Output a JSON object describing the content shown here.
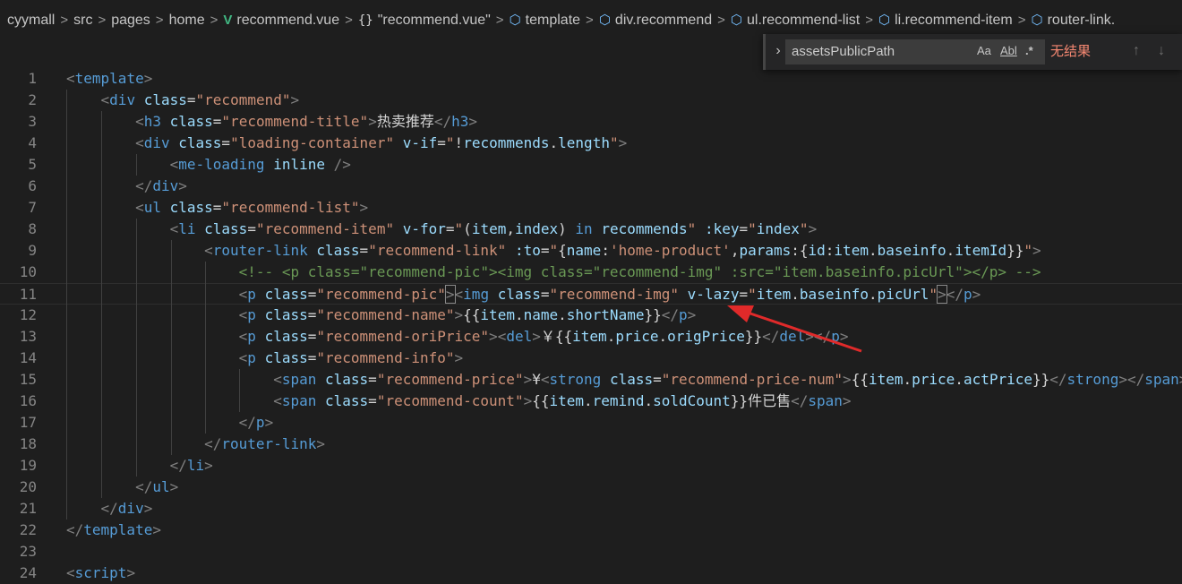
{
  "breadcrumb": [
    {
      "label": "cyymall",
      "icon": ""
    },
    {
      "label": "src",
      "icon": ""
    },
    {
      "label": "pages",
      "icon": ""
    },
    {
      "label": "home",
      "icon": ""
    },
    {
      "label": "recommend.vue",
      "icon": "vue-icon"
    },
    {
      "label": "\"recommend.vue\"",
      "icon": "braces-icon"
    },
    {
      "label": "template",
      "icon": "cube-icon"
    },
    {
      "label": "div.recommend",
      "icon": "cube-icon"
    },
    {
      "label": "ul.recommend-list",
      "icon": "cube-icon"
    },
    {
      "label": "li.recommend-item",
      "icon": "cube-icon"
    },
    {
      "label": "router-link.",
      "icon": "cube-icon"
    }
  ],
  "find_widget": {
    "query": "assetsPublicPath",
    "option_case": "Aa",
    "option_word": "Abl",
    "option_regex": ".*",
    "result": "无结果",
    "prev_icon": "arrow-up-icon",
    "next_icon": "arrow-down-icon"
  },
  "editor": {
    "current_line": 11,
    "lines": [
      {
        "n": "1",
        "tokens": [
          [
            "b",
            "<"
          ],
          [
            "t",
            "template"
          ],
          [
            "b",
            ">"
          ]
        ]
      },
      {
        "n": "2",
        "tokens": [
          [
            "x",
            "    "
          ],
          [
            "b",
            "<"
          ],
          [
            "t",
            "div"
          ],
          [
            "x",
            " "
          ],
          [
            "a",
            "class"
          ],
          [
            "x",
            "="
          ],
          [
            "s",
            "\"recommend\""
          ],
          [
            "b",
            ">"
          ]
        ]
      },
      {
        "n": "3",
        "tokens": [
          [
            "x",
            "        "
          ],
          [
            "b",
            "<"
          ],
          [
            "t",
            "h3"
          ],
          [
            "x",
            " "
          ],
          [
            "a",
            "class"
          ],
          [
            "x",
            "="
          ],
          [
            "s",
            "\"recommend-title\""
          ],
          [
            "b",
            ">"
          ],
          [
            "x",
            "热卖推荐"
          ],
          [
            "b",
            "</"
          ],
          [
            "t",
            "h3"
          ],
          [
            "b",
            ">"
          ]
        ]
      },
      {
        "n": "4",
        "tokens": [
          [
            "x",
            "        "
          ],
          [
            "b",
            "<"
          ],
          [
            "t",
            "div"
          ],
          [
            "x",
            " "
          ],
          [
            "a",
            "class"
          ],
          [
            "x",
            "="
          ],
          [
            "s",
            "\"loading-container\""
          ],
          [
            "x",
            " "
          ],
          [
            "a",
            "v-if"
          ],
          [
            "x",
            "="
          ],
          [
            "s",
            "\""
          ],
          [
            "x",
            "!"
          ],
          [
            "v",
            "recommends"
          ],
          [
            "x",
            "."
          ],
          [
            "v",
            "length"
          ],
          [
            "s",
            "\""
          ],
          [
            "b",
            ">"
          ]
        ]
      },
      {
        "n": "5",
        "tokens": [
          [
            "x",
            "            "
          ],
          [
            "b",
            "<"
          ],
          [
            "t",
            "me-loading"
          ],
          [
            "x",
            " "
          ],
          [
            "a",
            "inline"
          ],
          [
            "x",
            " "
          ],
          [
            "b",
            "/>"
          ]
        ]
      },
      {
        "n": "6",
        "tokens": [
          [
            "x",
            "        "
          ],
          [
            "b",
            "</"
          ],
          [
            "t",
            "div"
          ],
          [
            "b",
            ">"
          ]
        ]
      },
      {
        "n": "7",
        "tokens": [
          [
            "x",
            "        "
          ],
          [
            "b",
            "<"
          ],
          [
            "t",
            "ul"
          ],
          [
            "x",
            " "
          ],
          [
            "a",
            "class"
          ],
          [
            "x",
            "="
          ],
          [
            "s",
            "\"recommend-list\""
          ],
          [
            "b",
            ">"
          ]
        ]
      },
      {
        "n": "8",
        "tokens": [
          [
            "x",
            "            "
          ],
          [
            "b",
            "<"
          ],
          [
            "t",
            "li"
          ],
          [
            "x",
            " "
          ],
          [
            "a",
            "class"
          ],
          [
            "x",
            "="
          ],
          [
            "s",
            "\"recommend-item\""
          ],
          [
            "x",
            " "
          ],
          [
            "a",
            "v-for"
          ],
          [
            "x",
            "="
          ],
          [
            "s",
            "\""
          ],
          [
            "x",
            "("
          ],
          [
            "v",
            "item"
          ],
          [
            "x",
            ","
          ],
          [
            "v",
            "index"
          ],
          [
            "x",
            ") "
          ],
          [
            "k",
            "in"
          ],
          [
            "x",
            " "
          ],
          [
            "v",
            "recommends"
          ],
          [
            "s",
            "\""
          ],
          [
            "x",
            " "
          ],
          [
            "a",
            ":key"
          ],
          [
            "x",
            "="
          ],
          [
            "s",
            "\""
          ],
          [
            "v",
            "index"
          ],
          [
            "s",
            "\""
          ],
          [
            "b",
            ">"
          ]
        ]
      },
      {
        "n": "9",
        "tokens": [
          [
            "x",
            "                "
          ],
          [
            "b",
            "<"
          ],
          [
            "t",
            "router-link"
          ],
          [
            "x",
            " "
          ],
          [
            "a",
            "class"
          ],
          [
            "x",
            "="
          ],
          [
            "s",
            "\"recommend-link\""
          ],
          [
            "x",
            " "
          ],
          [
            "a",
            ":to"
          ],
          [
            "x",
            "="
          ],
          [
            "s",
            "\""
          ],
          [
            "x",
            "{"
          ],
          [
            "v",
            "name"
          ],
          [
            "x",
            ":"
          ],
          [
            "s",
            "'home-product'"
          ],
          [
            "x",
            ","
          ],
          [
            "v",
            "params"
          ],
          [
            "x",
            ":{"
          ],
          [
            "v",
            "id"
          ],
          [
            "x",
            ":"
          ],
          [
            "v",
            "item"
          ],
          [
            "x",
            "."
          ],
          [
            "v",
            "baseinfo"
          ],
          [
            "x",
            "."
          ],
          [
            "v",
            "itemId"
          ],
          [
            "x",
            "}}"
          ],
          [
            "s",
            "\""
          ],
          [
            "b",
            ">"
          ]
        ]
      },
      {
        "n": "10",
        "tokens": [
          [
            "x",
            "                    "
          ],
          [
            "c",
            "<!-- <p class=\"recommend-pic\"><img class=\"recommend-img\" :src=\"item.baseinfo.picUrl\"></p> -->"
          ]
        ]
      },
      {
        "n": "11",
        "tokens": [
          [
            "x",
            "                    "
          ],
          [
            "b",
            "<"
          ],
          [
            "t",
            "p"
          ],
          [
            "x",
            " "
          ],
          [
            "a",
            "class"
          ],
          [
            "x",
            "="
          ],
          [
            "s",
            "\"recommend-pic\""
          ],
          [
            "m",
            ">"
          ],
          [
            "b",
            "<"
          ],
          [
            "t",
            "img"
          ],
          [
            "x",
            " "
          ],
          [
            "a",
            "class"
          ],
          [
            "x",
            "="
          ],
          [
            "s",
            "\"recommend-img\""
          ],
          [
            "x",
            " "
          ],
          [
            "a",
            "v-lazy"
          ],
          [
            "x",
            "="
          ],
          [
            "s",
            "\""
          ],
          [
            "v",
            "item"
          ],
          [
            "x",
            "."
          ],
          [
            "v",
            "baseinfo"
          ],
          [
            "x",
            "."
          ],
          [
            "v",
            "picUrl"
          ],
          [
            "s",
            "\""
          ],
          [
            "m",
            ">"
          ],
          [
            "b",
            "</"
          ],
          [
            "t",
            "p"
          ],
          [
            "b",
            ">"
          ]
        ]
      },
      {
        "n": "12",
        "tokens": [
          [
            "x",
            "                    "
          ],
          [
            "b",
            "<"
          ],
          [
            "t",
            "p"
          ],
          [
            "x",
            " "
          ],
          [
            "a",
            "class"
          ],
          [
            "x",
            "="
          ],
          [
            "s",
            "\"recommend-name\""
          ],
          [
            "b",
            ">"
          ],
          [
            "x",
            "{{"
          ],
          [
            "v",
            "item"
          ],
          [
            "x",
            "."
          ],
          [
            "v",
            "name"
          ],
          [
            "x",
            "."
          ],
          [
            "v",
            "shortName"
          ],
          [
            "x",
            "}}"
          ],
          [
            "b",
            "</"
          ],
          [
            "t",
            "p"
          ],
          [
            "b",
            ">"
          ]
        ]
      },
      {
        "n": "13",
        "tokens": [
          [
            "x",
            "                    "
          ],
          [
            "b",
            "<"
          ],
          [
            "t",
            "p"
          ],
          [
            "x",
            " "
          ],
          [
            "a",
            "class"
          ],
          [
            "x",
            "="
          ],
          [
            "s",
            "\"recommend-oriPrice\""
          ],
          [
            "b",
            ">"
          ],
          [
            "b",
            "<"
          ],
          [
            "t",
            "del"
          ],
          [
            "b",
            ">"
          ],
          [
            "x",
            "￥{{"
          ],
          [
            "v",
            "item"
          ],
          [
            "x",
            "."
          ],
          [
            "v",
            "price"
          ],
          [
            "x",
            "."
          ],
          [
            "v",
            "origPrice"
          ],
          [
            "x",
            "}}"
          ],
          [
            "b",
            "</"
          ],
          [
            "t",
            "del"
          ],
          [
            "b",
            ">"
          ],
          [
            "b",
            "</"
          ],
          [
            "t",
            "p"
          ],
          [
            "b",
            ">"
          ]
        ]
      },
      {
        "n": "14",
        "tokens": [
          [
            "x",
            "                    "
          ],
          [
            "b",
            "<"
          ],
          [
            "t",
            "p"
          ],
          [
            "x",
            " "
          ],
          [
            "a",
            "class"
          ],
          [
            "x",
            "="
          ],
          [
            "s",
            "\"recommend-info\""
          ],
          [
            "b",
            ">"
          ]
        ]
      },
      {
        "n": "15",
        "tokens": [
          [
            "x",
            "                        "
          ],
          [
            "b",
            "<"
          ],
          [
            "t",
            "span"
          ],
          [
            "x",
            " "
          ],
          [
            "a",
            "class"
          ],
          [
            "x",
            "="
          ],
          [
            "s",
            "\"recommend-price\""
          ],
          [
            "b",
            ">"
          ],
          [
            "x",
            "¥"
          ],
          [
            "b",
            "<"
          ],
          [
            "t",
            "strong"
          ],
          [
            "x",
            " "
          ],
          [
            "a",
            "class"
          ],
          [
            "x",
            "="
          ],
          [
            "s",
            "\"recommend-price-num\""
          ],
          [
            "b",
            ">"
          ],
          [
            "x",
            "{{"
          ],
          [
            "v",
            "item"
          ],
          [
            "x",
            "."
          ],
          [
            "v",
            "price"
          ],
          [
            "x",
            "."
          ],
          [
            "v",
            "actPrice"
          ],
          [
            "x",
            "}}"
          ],
          [
            "b",
            "</"
          ],
          [
            "t",
            "strong"
          ],
          [
            "b",
            "></"
          ],
          [
            "t",
            "span"
          ],
          [
            "b",
            ">"
          ]
        ]
      },
      {
        "n": "16",
        "tokens": [
          [
            "x",
            "                        "
          ],
          [
            "b",
            "<"
          ],
          [
            "t",
            "span"
          ],
          [
            "x",
            " "
          ],
          [
            "a",
            "class"
          ],
          [
            "x",
            "="
          ],
          [
            "s",
            "\"recommend-count\""
          ],
          [
            "b",
            ">"
          ],
          [
            "x",
            "{{"
          ],
          [
            "v",
            "item"
          ],
          [
            "x",
            "."
          ],
          [
            "v",
            "remind"
          ],
          [
            "x",
            "."
          ],
          [
            "v",
            "soldCount"
          ],
          [
            "x",
            "}}件已售"
          ],
          [
            "b",
            "</"
          ],
          [
            "t",
            "span"
          ],
          [
            "b",
            ">"
          ]
        ]
      },
      {
        "n": "17",
        "tokens": [
          [
            "x",
            "                    "
          ],
          [
            "b",
            "</"
          ],
          [
            "t",
            "p"
          ],
          [
            "b",
            ">"
          ]
        ]
      },
      {
        "n": "18",
        "tokens": [
          [
            "x",
            "                "
          ],
          [
            "b",
            "</"
          ],
          [
            "t",
            "router-link"
          ],
          [
            "b",
            ">"
          ]
        ]
      },
      {
        "n": "19",
        "tokens": [
          [
            "x",
            "            "
          ],
          [
            "b",
            "</"
          ],
          [
            "t",
            "li"
          ],
          [
            "b",
            ">"
          ]
        ]
      },
      {
        "n": "20",
        "tokens": [
          [
            "x",
            "        "
          ],
          [
            "b",
            "</"
          ],
          [
            "t",
            "ul"
          ],
          [
            "b",
            ">"
          ]
        ]
      },
      {
        "n": "21",
        "tokens": [
          [
            "x",
            "    "
          ],
          [
            "b",
            "</"
          ],
          [
            "t",
            "div"
          ],
          [
            "b",
            ">"
          ]
        ]
      },
      {
        "n": "22",
        "tokens": [
          [
            "b",
            "</"
          ],
          [
            "t",
            "template"
          ],
          [
            "b",
            ">"
          ]
        ]
      },
      {
        "n": "23",
        "tokens": []
      },
      {
        "n": "24",
        "tokens": [
          [
            "b",
            "<"
          ],
          [
            "t",
            "script"
          ],
          [
            "b",
            ">"
          ]
        ]
      }
    ]
  },
  "colors": {
    "background": "#1e1e1e",
    "arrow": "#e02a2a",
    "find_no_result": "#f48771"
  }
}
